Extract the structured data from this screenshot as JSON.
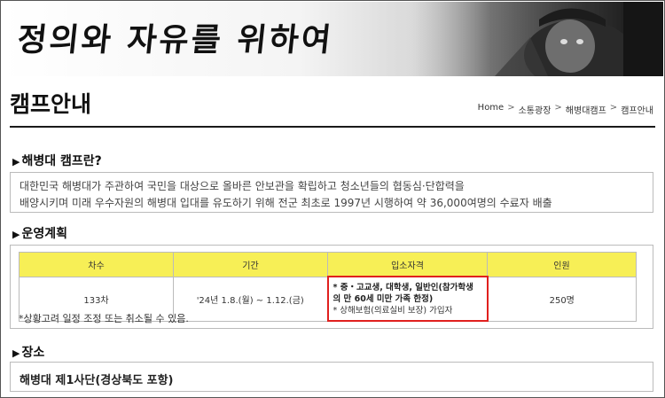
{
  "banner": {
    "slogan": "정의와 자유를 위하여"
  },
  "header": {
    "title": "캠프안내",
    "breadcrumb": [
      "Home",
      "소통광장",
      "해병대캠프",
      "캠프안내"
    ],
    "separator": ">"
  },
  "intro": {
    "heading_marker": "▶",
    "heading": "해병대 캠프란?",
    "lines": [
      "대한민국 해병대가 주관하여 국민을 대상으로 올바른 안보관을 확립하고 청소년들의 협동심·단합력을",
      "배양시키며 미래 우수자원의 해병대 입대를 유도하기 위해 전군 최초로 1997년 시행하여 약 36,000여명의 수료자 배출"
    ]
  },
  "operation": {
    "heading_marker": "▶",
    "heading": "운영계획",
    "columns": [
      "차수",
      "기간",
      "입소자격",
      "인원"
    ],
    "row": {
      "round": "133차",
      "period": "'24년 1.8.(월) ~ 1.12.(금)",
      "qualification_line1": "* 중・고교생, 대학생, 일반인(참가학생",
      "qualification_line2": "의 만 60세 미만 가족 한정)",
      "qualification_line3": "* 상해보험(의료실비 보장) 가입자",
      "count": "250명"
    },
    "note": "*상황고려 일정 조정 또는 취소될 수 있음."
  },
  "place": {
    "heading_marker": "▶",
    "heading": "장소",
    "value": "해병대 제1사단(경상북도 포항)"
  },
  "colors": {
    "table_header": "#f7ef56",
    "highlight_border": "#e0201e"
  }
}
